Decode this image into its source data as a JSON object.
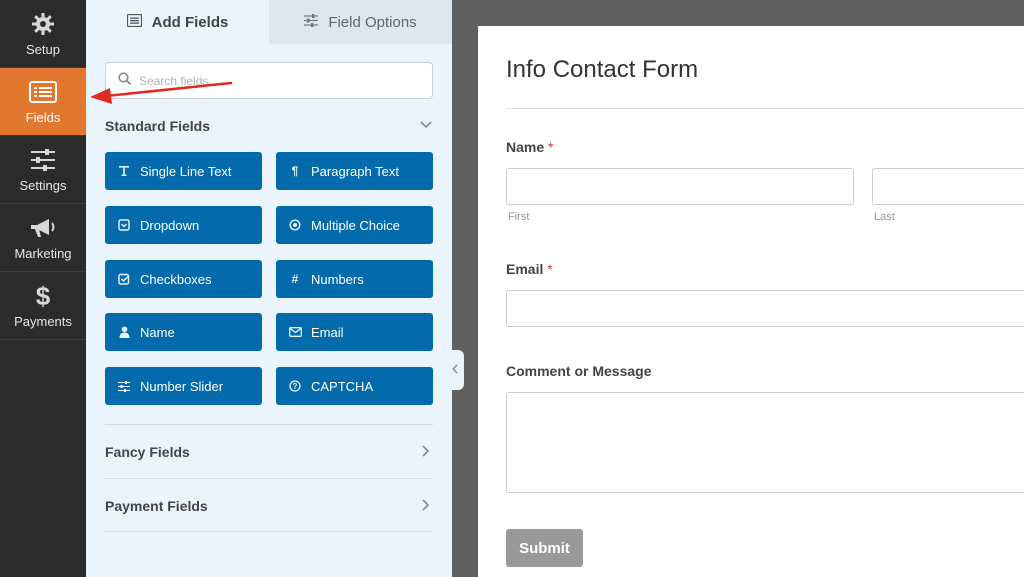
{
  "nav": {
    "setup": "Setup",
    "fields": "Fields",
    "settings": "Settings",
    "marketing": "Marketing",
    "payments": "Payments"
  },
  "tabs": {
    "add_fields": "Add Fields",
    "field_options": "Field Options"
  },
  "search": {
    "placeholder": "Search fields..."
  },
  "sections": {
    "standard": "Standard Fields",
    "fancy": "Fancy Fields",
    "payment": "Payment Fields"
  },
  "standard_fields": [
    {
      "label": "Single Line Text",
      "icon": "text-icon"
    },
    {
      "label": "Paragraph Text",
      "icon": "paragraph-icon"
    },
    {
      "label": "Dropdown",
      "icon": "dropdown-icon"
    },
    {
      "label": "Multiple Choice",
      "icon": "radio-icon"
    },
    {
      "label": "Checkboxes",
      "icon": "checkbox-icon"
    },
    {
      "label": "Numbers",
      "icon": "hash-icon"
    },
    {
      "label": "Name",
      "icon": "user-icon"
    },
    {
      "label": "Email",
      "icon": "envelope-icon"
    },
    {
      "label": "Number Slider",
      "icon": "sliders-icon"
    },
    {
      "label": "CAPTCHA",
      "icon": "question-circle-icon"
    }
  ],
  "form": {
    "title": "Info Contact Form",
    "name_label": "Name",
    "required_mark": "*",
    "first": "First",
    "last": "Last",
    "email_label": "Email",
    "comment_label": "Comment or Message",
    "submit": "Submit"
  },
  "colors": {
    "nav_bg": "#2b2b2b",
    "nav_active": "#e27730",
    "field_button": "#036aab",
    "annotation_arrow": "#e02b20"
  }
}
